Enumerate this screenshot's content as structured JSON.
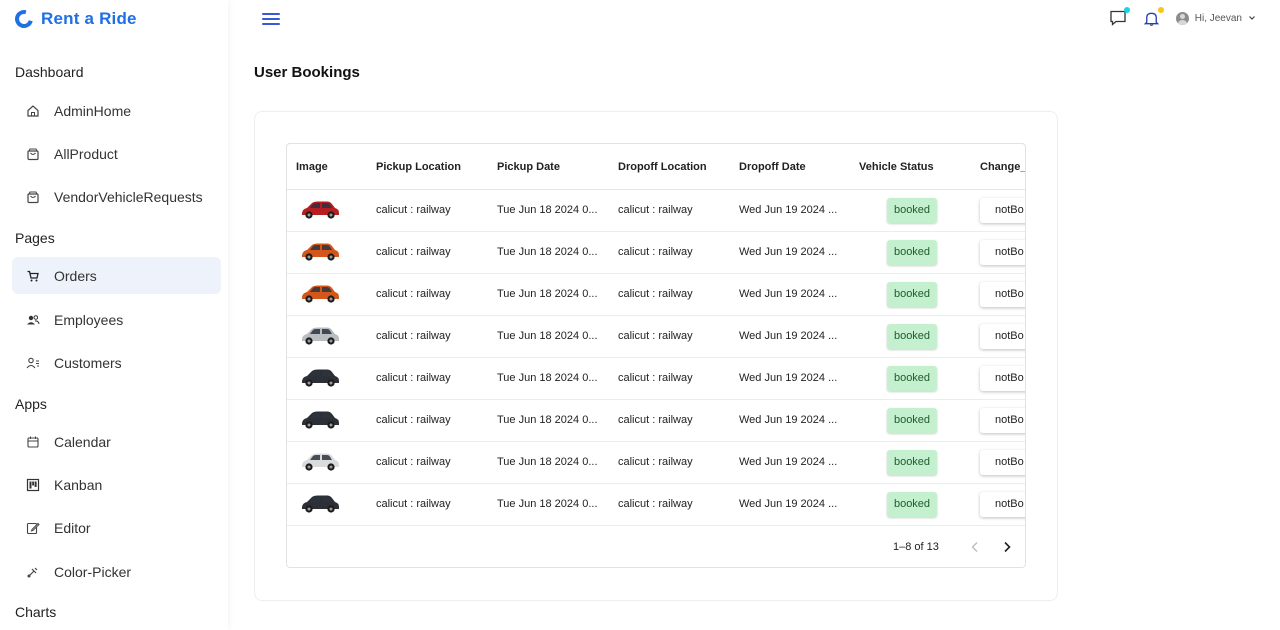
{
  "brand": {
    "name": "Rent a Ride",
    "color": "#1f6fe5"
  },
  "sidebar": {
    "sections": [
      {
        "title": "Dashboard",
        "items": [
          {
            "label": "AdminHome",
            "icon": "home-icon"
          },
          {
            "label": "AllProduct",
            "icon": "shopping-bag-icon"
          },
          {
            "label": "VendorVehicleRequests",
            "icon": "shopping-bag-icon"
          }
        ]
      },
      {
        "title": "Pages",
        "items": [
          {
            "label": "Orders",
            "icon": "cart-icon",
            "active": true
          },
          {
            "label": "Employees",
            "icon": "people-icon"
          },
          {
            "label": "Customers",
            "icon": "contact-list-icon"
          }
        ]
      },
      {
        "title": "Apps",
        "items": [
          {
            "label": "Calendar",
            "icon": "calendar-icon"
          },
          {
            "label": "Kanban",
            "icon": "kanban-icon"
          },
          {
            "label": "Editor",
            "icon": "edit-icon"
          },
          {
            "label": "Color-Picker",
            "icon": "color-picker-icon"
          }
        ]
      },
      {
        "title": "Charts",
        "items": []
      }
    ]
  },
  "topbar": {
    "menu_icon": "hamburger-icon",
    "chat_icon": "chat-icon",
    "chat_dot_color": "#19d3e6",
    "bell_icon": "bell-icon",
    "bell_dot_color": "#f5c518",
    "greeting": "Hi, Jeevan",
    "dropdown_icon": "chevron-down-icon"
  },
  "page": {
    "title": "User Bookings"
  },
  "table": {
    "columns": [
      "Image",
      "Pickup Location",
      "Pickup Date",
      "Dropoff Location",
      "Dropoff Date",
      "Vehicle Status",
      "Change_"
    ],
    "rows": [
      {
        "car_color": "#b81d22",
        "pickup_location": "calicut : railway",
        "pickup_date": "Tue Jun 18 2024 0...",
        "dropoff_location": "calicut : railway",
        "dropoff_date": "Wed Jun 19 2024 ...",
        "status": "booked",
        "change": "notBo"
      },
      {
        "car_color": "#d4561a",
        "pickup_location": "calicut : railway",
        "pickup_date": "Tue Jun 18 2024 0...",
        "dropoff_location": "calicut : railway",
        "dropoff_date": "Wed Jun 19 2024 ...",
        "status": "booked",
        "change": "notBo"
      },
      {
        "car_color": "#d4561a",
        "pickup_location": "calicut : railway",
        "pickup_date": "Tue Jun 18 2024 0...",
        "dropoff_location": "calicut : railway",
        "dropoff_date": "Wed Jun 19 2024 ...",
        "status": "booked",
        "change": "notBo"
      },
      {
        "car_color": "#b9bcc0",
        "pickup_location": "calicut : railway",
        "pickup_date": "Tue Jun 18 2024 0...",
        "dropoff_location": "calicut : railway",
        "dropoff_date": "Wed Jun 19 2024 ...",
        "status": "booked",
        "change": "notBo"
      },
      {
        "car_color": "#2c2f35",
        "pickup_location": "calicut : railway",
        "pickup_date": "Tue Jun 18 2024 0...",
        "dropoff_location": "calicut : railway",
        "dropoff_date": "Wed Jun 19 2024 ...",
        "status": "booked",
        "change": "notBo"
      },
      {
        "car_color": "#2c2f35",
        "pickup_location": "calicut : railway",
        "pickup_date": "Tue Jun 18 2024 0...",
        "dropoff_location": "calicut : railway",
        "dropoff_date": "Wed Jun 19 2024 ...",
        "status": "booked",
        "change": "notBo"
      },
      {
        "car_color": "#d9dbdd",
        "pickup_location": "calicut : railway",
        "pickup_date": "Tue Jun 18 2024 0...",
        "dropoff_location": "calicut : railway",
        "dropoff_date": "Wed Jun 19 2024 ...",
        "status": "booked",
        "change": "notBo"
      },
      {
        "car_color": "#2c2f35",
        "pickup_location": "calicut : railway",
        "pickup_date": "Tue Jun 18 2024 0...",
        "dropoff_location": "calicut : railway",
        "dropoff_date": "Wed Jun 19 2024 ...",
        "status": "booked",
        "change": "notBo"
      }
    ],
    "pagination": {
      "text": "1–8 of 13",
      "prev_icon": "chevron-left-icon",
      "next_icon": "chevron-right-icon"
    },
    "status_color": "#c4f0cf"
  }
}
